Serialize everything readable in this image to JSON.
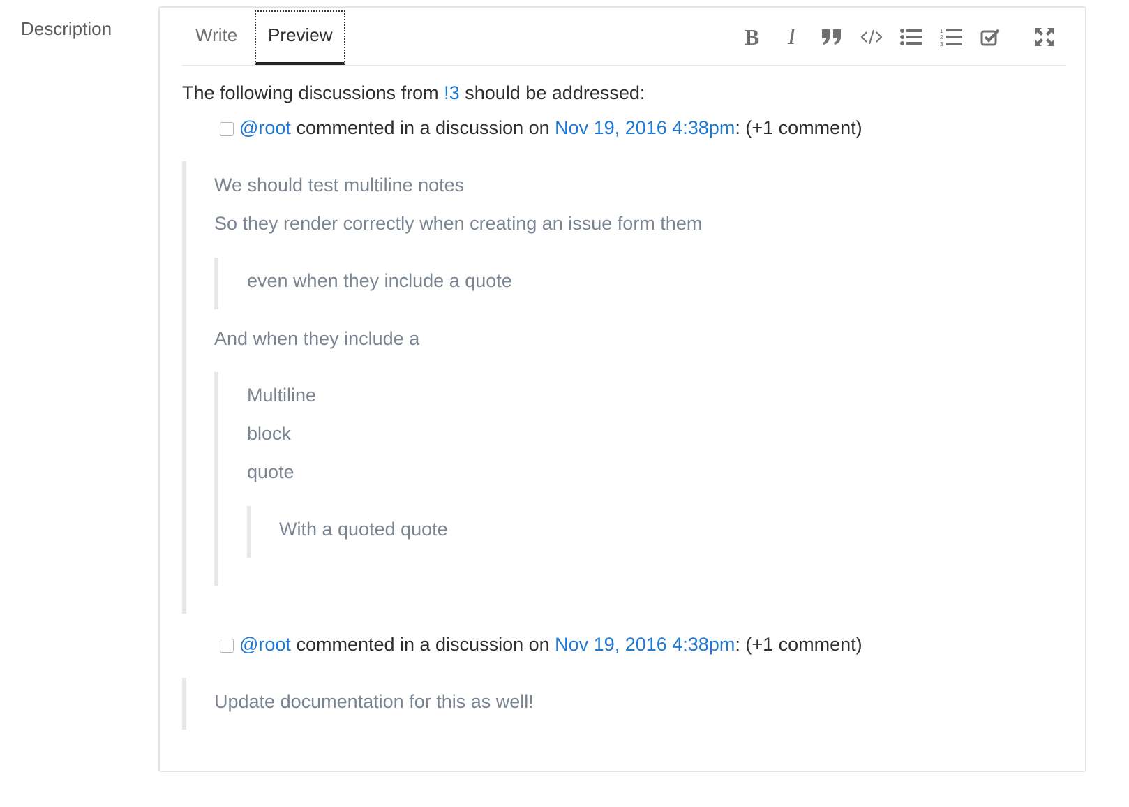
{
  "field_label": "Description",
  "tabs": [
    {
      "label": "Write",
      "active": false
    },
    {
      "label": "Preview",
      "active": true
    }
  ],
  "toolbar": {
    "bold": "B",
    "italic": "I",
    "icons": [
      "bold-icon",
      "italic-icon",
      "quote-icon",
      "code-icon",
      "bullet-list-icon",
      "numbered-list-icon",
      "task-list-icon",
      "fullscreen-icon"
    ]
  },
  "preview": {
    "intro_prefix": "The following discussions from ",
    "intro_link": "!3",
    "intro_suffix": " should be addressed:",
    "tasks": [
      {
        "checked": false,
        "user": "@root",
        "middle": " commented in a discussion on ",
        "date_link": "Nov 19, 2016 4:38pm",
        "suffix": ": (+1 comment)"
      },
      {
        "checked": false,
        "user": "@root",
        "middle": " commented in a discussion on ",
        "date_link": "Nov 19, 2016 4:38pm",
        "suffix": ": (+1 comment)"
      }
    ],
    "quote1": {
      "line1": "We should test multiline notes",
      "line2": "So they render correctly when creating an issue form them",
      "nested_quote": "even when they include a quote",
      "line3": "And when they include a",
      "multiline_block": [
        "Multiline",
        "block",
        "quote"
      ],
      "quoted_quote": "With a quoted quote"
    },
    "quote2": "Update documentation for this as well!"
  },
  "colors": {
    "link": "#1f78d1",
    "muted_quote_text": "#7b8591",
    "border": "#e5e5e5"
  }
}
